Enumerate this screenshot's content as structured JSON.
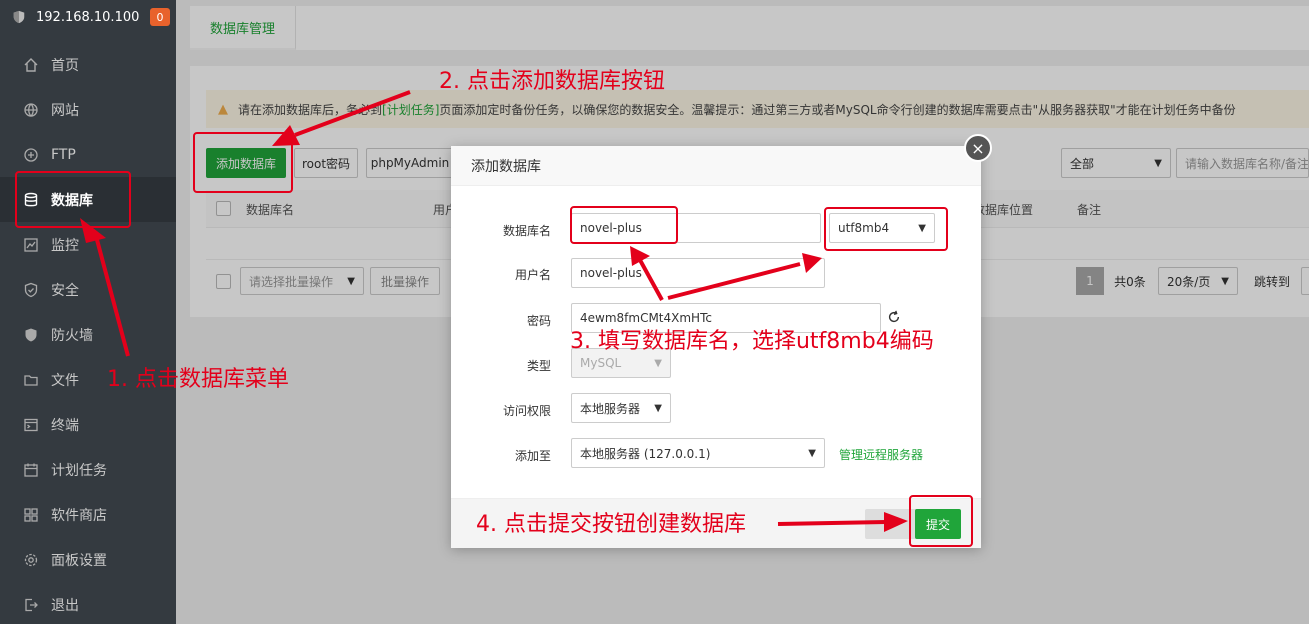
{
  "sidebar": {
    "server_ip": "192.168.10.100",
    "badge_count": "0",
    "items": [
      {
        "label": "首页",
        "icon": "home-icon"
      },
      {
        "label": "网站",
        "icon": "globe-icon"
      },
      {
        "label": "FTP",
        "icon": "ftp-icon"
      },
      {
        "label": "数据库",
        "icon": "database-icon",
        "active": true
      },
      {
        "label": "监控",
        "icon": "monitor-icon"
      },
      {
        "label": "安全",
        "icon": "shield-check-icon"
      },
      {
        "label": "防火墙",
        "icon": "firewall-icon"
      },
      {
        "label": "文件",
        "icon": "folder-icon"
      },
      {
        "label": "终端",
        "icon": "terminal-icon"
      },
      {
        "label": "计划任务",
        "icon": "calendar-icon"
      },
      {
        "label": "软件商店",
        "icon": "apps-icon"
      },
      {
        "label": "面板设置",
        "icon": "settings-icon"
      },
      {
        "label": "退出",
        "icon": "logout-icon"
      }
    ]
  },
  "topbar": {
    "tab_label": "数据库管理"
  },
  "notice": {
    "prefix": "请在添加数据库后，务必到",
    "link": "[计划任务]",
    "suffix": "页面添加定时备份任务，以确保您的数据安全。温馨提示：通过第三方或者MySQL命令行创建的数据库需要点击\"从服务器获取\"才能在计划任务中备份"
  },
  "toolbar": {
    "add_db": "添加数据库",
    "root_pwd": "root密码",
    "phpmyadmin": "phpMyAdmin",
    "filter_value": "全部",
    "search_placeholder": "请输入数据库名称/备注"
  },
  "table": {
    "headers": [
      "数据库名",
      "用户",
      "数据库位置",
      "备注"
    ]
  },
  "footer_bar": {
    "batch_placeholder": "请选择批量操作",
    "batch_btn": "批量操作",
    "page_current": "1",
    "total": "共0条",
    "per_page": "20条/页",
    "jump": "跳转到"
  },
  "modal": {
    "title": "添加数据库",
    "close": "×",
    "fields": {
      "dbname_label": "数据库名",
      "dbname_value": "novel-plus",
      "charset_value": "utf8mb4",
      "user_label": "用户名",
      "user_value": "novel-plus",
      "pwd_label": "密码",
      "pwd_value": "4ewm8fmCMt4XmHTc",
      "type_label": "类型",
      "type_value": "MySQL",
      "access_label": "访问权限",
      "access_value": "本地服务器",
      "addto_label": "添加至",
      "addto_value": "本地服务器 (127.0.0.1)",
      "manage_remote": "管理远程服务器"
    },
    "submit": "提交"
  },
  "annotations": {
    "step1": "1. 点击数据库菜单",
    "step2": "2. 点击添加数据库按钮",
    "step3": "3. 填写数据库名，选择utf8mb4编码",
    "step4": "4. 点击提交按钮创建数据库",
    "color": "#e3001b"
  }
}
